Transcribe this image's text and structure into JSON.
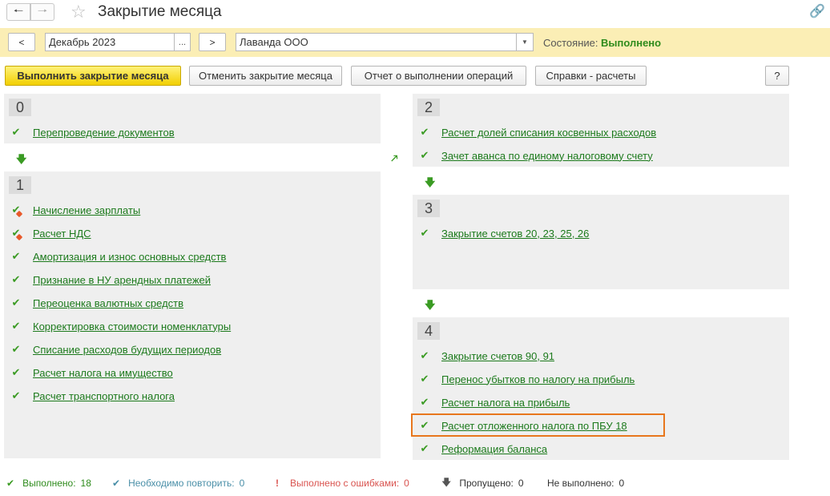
{
  "window": {
    "title": "Закрытие месяца",
    "back_icon": "arrow-left-icon",
    "forward_icon": "arrow-right-icon",
    "favorite_icon": "star-icon",
    "link_icon": "link-icon"
  },
  "period_bar": {
    "prev_label": "<",
    "period_value": "Декабрь 2023",
    "period_select_label": "...",
    "next_label": ">",
    "organization_value": "Лаванда ООО",
    "state_label": "Состояние:",
    "state_value": "Выполнено"
  },
  "actions": {
    "run_label": "Выполнить закрытие месяца",
    "cancel_label": "Отменить закрытие месяца",
    "report_label": "Отчет о выполнении операций",
    "help_calc_label": "Справки - расчеты",
    "help_label": "?"
  },
  "steps": [
    {
      "number": "0",
      "items": [
        {
          "label": "Перепроведение документов",
          "status": "done"
        }
      ]
    },
    {
      "number": "1",
      "items": [
        {
          "label": "Начисление зарплаты",
          "status": "done-warning"
        },
        {
          "label": "Расчет НДС",
          "status": "done-warning"
        },
        {
          "label": "Амортизация и износ основных средств",
          "status": "done"
        },
        {
          "label": "Признание в НУ арендных платежей",
          "status": "done"
        },
        {
          "label": "Переоценка валютных средств",
          "status": "done"
        },
        {
          "label": "Корректировка стоимости номенклатуры",
          "status": "done"
        },
        {
          "label": "Списание расходов будущих периодов",
          "status": "done"
        },
        {
          "label": "Расчет налога на имущество",
          "status": "done"
        },
        {
          "label": "Расчет транспортного налога",
          "status": "done"
        }
      ]
    },
    {
      "number": "2",
      "items": [
        {
          "label": "Расчет долей списания косвенных расходов",
          "status": "done"
        },
        {
          "label": "Зачет аванса по единому налоговому счету",
          "status": "done"
        }
      ]
    },
    {
      "number": "3",
      "items": [
        {
          "label": "Закрытие счетов 20, 23, 25, 26",
          "status": "done"
        }
      ]
    },
    {
      "number": "4",
      "items": [
        {
          "label": "Закрытие счетов 90, 91",
          "status": "done"
        },
        {
          "label": "Перенос убытков по налогу на прибыль",
          "status": "done"
        },
        {
          "label": "Расчет налога на прибыль",
          "status": "done"
        },
        {
          "label": "Расчет отложенного налога по ПБУ 18",
          "status": "done"
        },
        {
          "label": "Реформация баланса",
          "status": "done"
        }
      ]
    }
  ],
  "legend": {
    "done_label": "Выполнено:",
    "done_count": "18",
    "repeat_label": "Необходимо повторить:",
    "repeat_count": "0",
    "errors_label": "Выполнено с ошибками:",
    "errors_count": "0",
    "skipped_label": "Пропущено:",
    "skipped_count": "0",
    "not_done_label": "Не выполнено:",
    "not_done_count": "0"
  },
  "colors": {
    "accent_yellow": "#fbeeb5",
    "success_green": "#2e8b1c",
    "link_green": "#1c7a1c",
    "highlight_orange": "#e8771d",
    "repeat_teal": "#4a8fa8",
    "error_red": "#d9534f"
  }
}
